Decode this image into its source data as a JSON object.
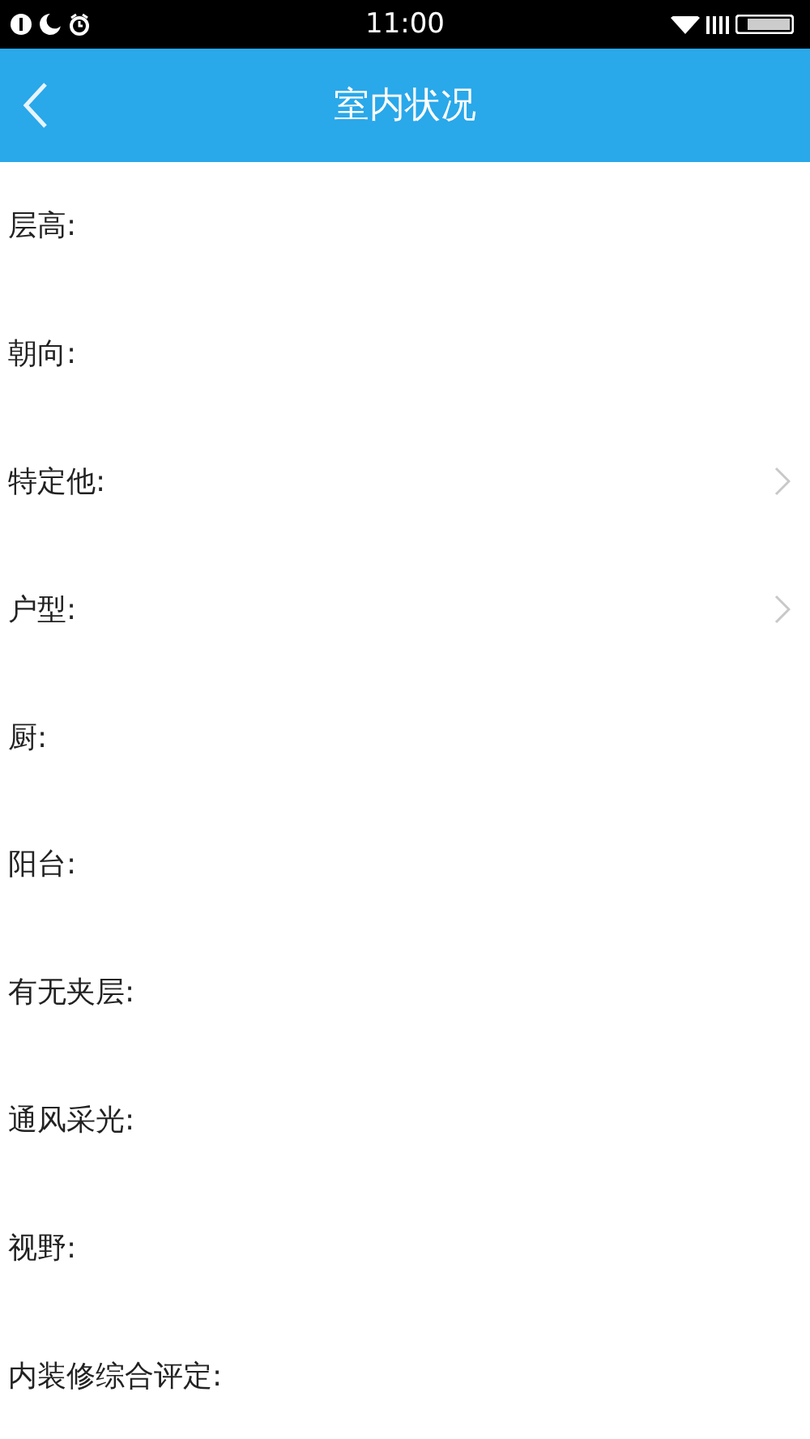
{
  "status_bar": {
    "time": "11:00"
  },
  "header": {
    "title": "室内状况"
  },
  "rows": [
    {
      "label": "层高:",
      "kind": "plain"
    },
    {
      "label": "朝向:",
      "kind": "plain"
    },
    {
      "label": "特定他:",
      "kind": "select"
    },
    {
      "label": "户型:",
      "kind": "select"
    },
    {
      "label": "厨:",
      "kind": "plain"
    },
    {
      "label": "阳台:",
      "kind": "plain"
    },
    {
      "label": "有无夹层:",
      "kind": "plain"
    },
    {
      "label": "通风采光:",
      "kind": "plain"
    },
    {
      "label": "视野:",
      "kind": "plain"
    },
    {
      "label": "内装修综合评定:",
      "kind": "plain"
    }
  ]
}
